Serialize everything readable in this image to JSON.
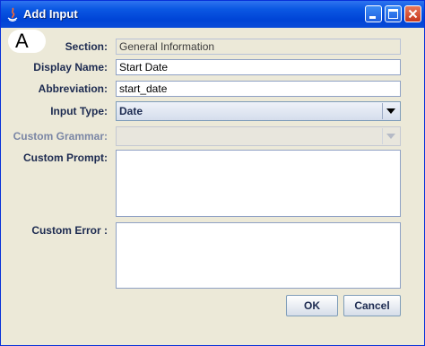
{
  "window": {
    "title": "Add Input",
    "marker": "A"
  },
  "form": {
    "section": {
      "label": "Section:",
      "value": "General Information"
    },
    "display_name": {
      "label": "Display Name:",
      "value": "Start Date"
    },
    "abbreviation": {
      "label": "Abbreviation:",
      "value": "start_date"
    },
    "input_type": {
      "label": "Input Type:",
      "value": "Date"
    },
    "custom_grammar": {
      "label": "Custom Grammar:",
      "value": ""
    },
    "custom_prompt": {
      "label": "Custom Prompt:",
      "value": ""
    },
    "custom_error": {
      "label": "Custom Error :",
      "value": ""
    }
  },
  "buttons": {
    "ok": "OK",
    "cancel": "Cancel"
  },
  "colors": {
    "titlebar": "#0044d6",
    "dialog_background": "#ece9d8",
    "label_text": "#1c2a50"
  },
  "icons": [
    "app-icon",
    "minimize-icon",
    "maximize-icon",
    "close-icon",
    "dropdown-arrow-icon"
  ]
}
